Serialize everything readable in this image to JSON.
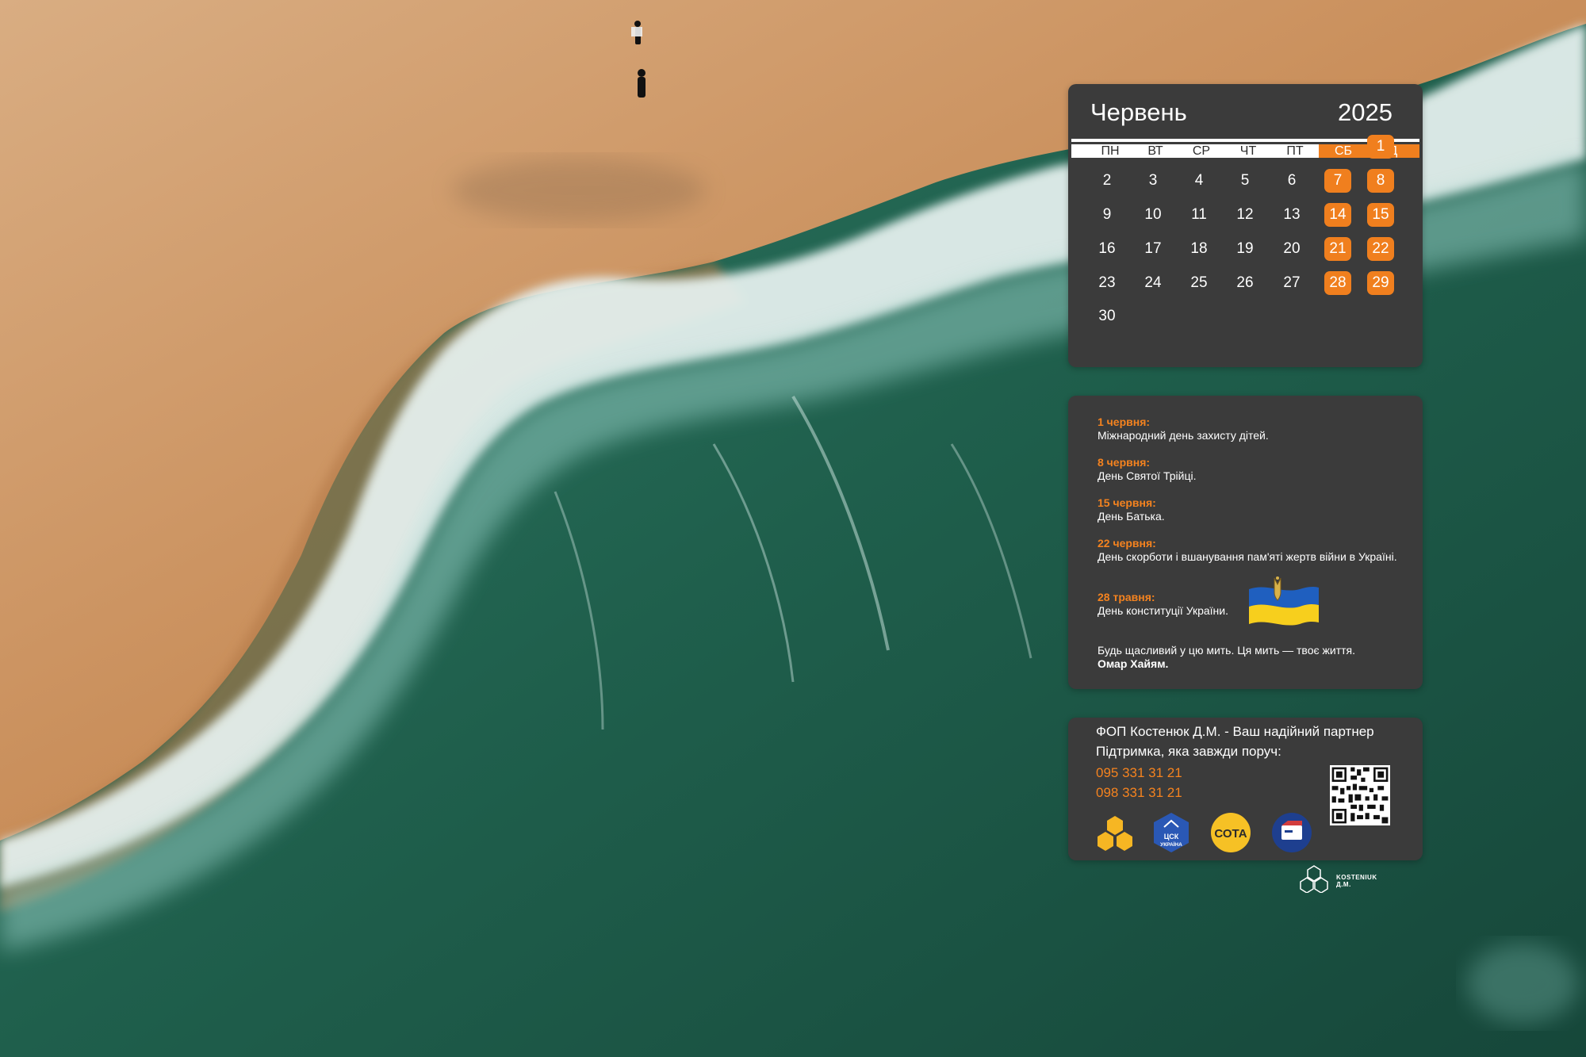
{
  "calendar": {
    "month": "Червень",
    "year": "2025",
    "weekdays": [
      "ПН",
      "ВТ",
      "СР",
      "ЧТ",
      "ПТ",
      "СБ",
      "НД"
    ],
    "weeks": [
      [
        "",
        "",
        "",
        "",
        "",
        "",
        "1"
      ],
      [
        "2",
        "3",
        "4",
        "5",
        "6",
        "7",
        "8"
      ],
      [
        "9",
        "10",
        "11",
        "12",
        "13",
        "14",
        "15"
      ],
      [
        "16",
        "17",
        "18",
        "19",
        "20",
        "21",
        "22"
      ],
      [
        "23",
        "24",
        "25",
        "26",
        "27",
        "28",
        "29"
      ],
      [
        "30",
        "",
        "",
        "",
        "",
        "",
        ""
      ]
    ]
  },
  "holidays": [
    {
      "date": "1 червня:",
      "name": "Міжнародний день захисту дітей."
    },
    {
      "date": "8 червня:",
      "name": "День Святої Трійці."
    },
    {
      "date": "15 червня:",
      "name": "День Батька."
    },
    {
      "date": "22 червня:",
      "name": "День скорботи і вшанування пам'яті жертв війни в Україні."
    },
    {
      "date": "28 травня:",
      "name": "День конституції України."
    }
  ],
  "quote": {
    "text": "Будь щасливий у цю мить. Ця мить — твоє життя.",
    "author": "Омар Хайям."
  },
  "contacts": {
    "line1": "ФОП Костенюк Д.М. - Ваш надійний партнер",
    "line2": "Підтримка, яка завжди поруч:",
    "phones": [
      "095 331 31 21",
      "098 331 31 21"
    ]
  },
  "logos": {
    "cck_line1": "ЦСК",
    "cck_line2": "УКРАЇНА",
    "sota": "СОТА"
  },
  "brand": "KOSTENIUK Д.М.",
  "colors": {
    "accent": "#f07f1e",
    "panel": "#3b3b3b"
  }
}
